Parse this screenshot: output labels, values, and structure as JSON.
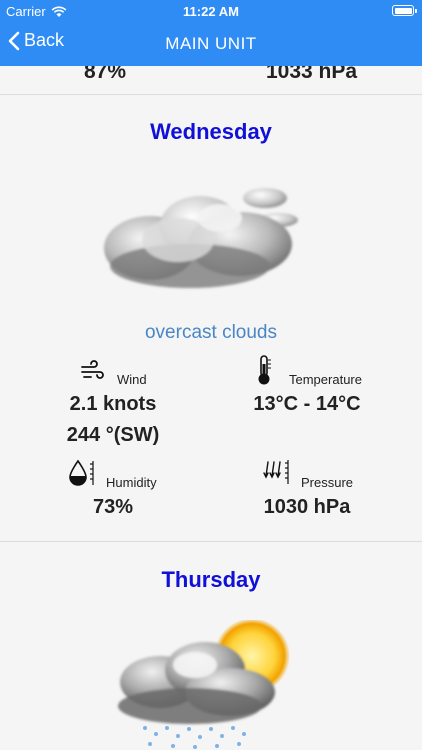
{
  "status_bar": {
    "carrier": "Carrier",
    "time": "11:22 AM"
  },
  "nav": {
    "back_label": "Back",
    "title": "MAIN UNIT"
  },
  "previous_day": {
    "humidity": "87%",
    "pressure": "1033 hPa"
  },
  "days": [
    {
      "name": "Wednesday",
      "condition": "overcast clouds",
      "wind_label": "Wind",
      "wind_speed": "2.1 knots",
      "wind_direction": "244 °(SW)",
      "temperature_label": "Temperature",
      "temperature": "13°C - 14°C",
      "humidity_label": "Humidity",
      "humidity": "73%",
      "pressure_label": "Pressure",
      "pressure": "1030 hPa",
      "icon": "overcast-clouds-icon"
    },
    {
      "name": "Thursday",
      "icon": "rain-sun-icon"
    }
  ],
  "colors": {
    "nav_bar": "#2f8cf5",
    "day_title": "#1010d8",
    "condition_text": "#4a86c6"
  }
}
